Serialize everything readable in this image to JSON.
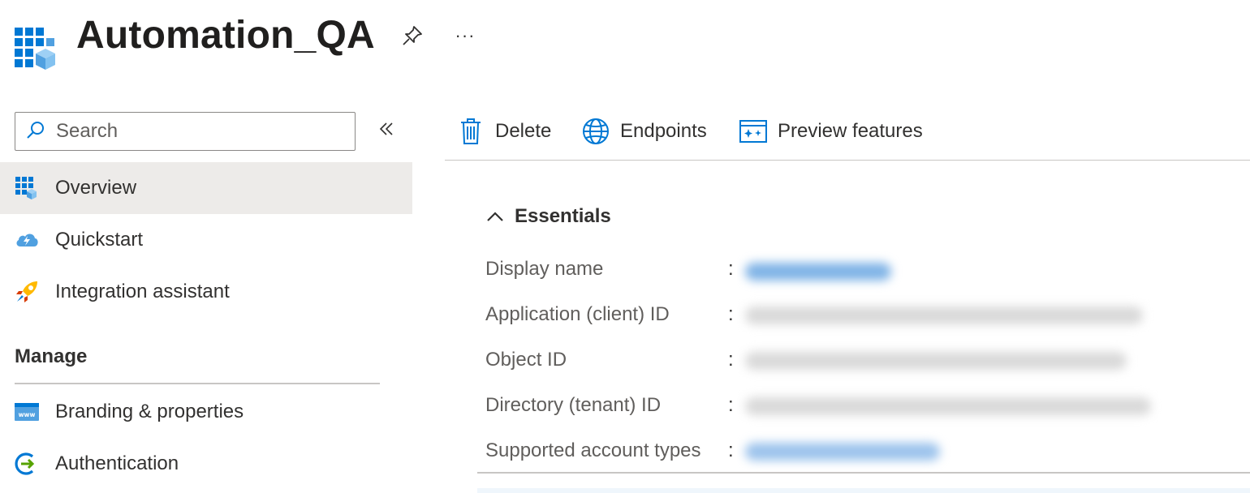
{
  "header": {
    "title": "Automation_QA",
    "app_icon": "app-registration-icon",
    "pin_icon": "pin-icon",
    "more_label": "···"
  },
  "sidebar": {
    "search": {
      "placeholder": "Search",
      "value": ""
    },
    "collapse_label": "«",
    "items": [
      {
        "label": "Overview",
        "icon": "overview-grid-icon",
        "active": true
      },
      {
        "label": "Quickstart",
        "icon": "quickstart-cloud-icon",
        "active": false
      },
      {
        "label": "Integration assistant",
        "icon": "rocket-icon",
        "active": false
      }
    ],
    "manage_header": "Manage",
    "manage_items": [
      {
        "label": "Branding & properties",
        "icon": "www-icon"
      },
      {
        "label": "Authentication",
        "icon": "authentication-icon"
      }
    ]
  },
  "toolbar": {
    "delete_label": "Delete",
    "endpoints_label": "Endpoints",
    "preview_label": "Preview features"
  },
  "essentials": {
    "title": "Essentials",
    "fields": [
      {
        "label": "Display name",
        "value_redacted": true
      },
      {
        "label": "Application (client) ID",
        "value_redacted": true
      },
      {
        "label": "Object ID",
        "value_redacted": true
      },
      {
        "label": "Directory (tenant) ID",
        "value_redacted": true
      },
      {
        "label": "Supported account types",
        "value_redacted": true
      }
    ]
  },
  "colors": {
    "accent": "#0078d4",
    "link": "#0078d4",
    "active_bg": "#edebe9",
    "text": "#323130",
    "label": "#605e5c"
  }
}
